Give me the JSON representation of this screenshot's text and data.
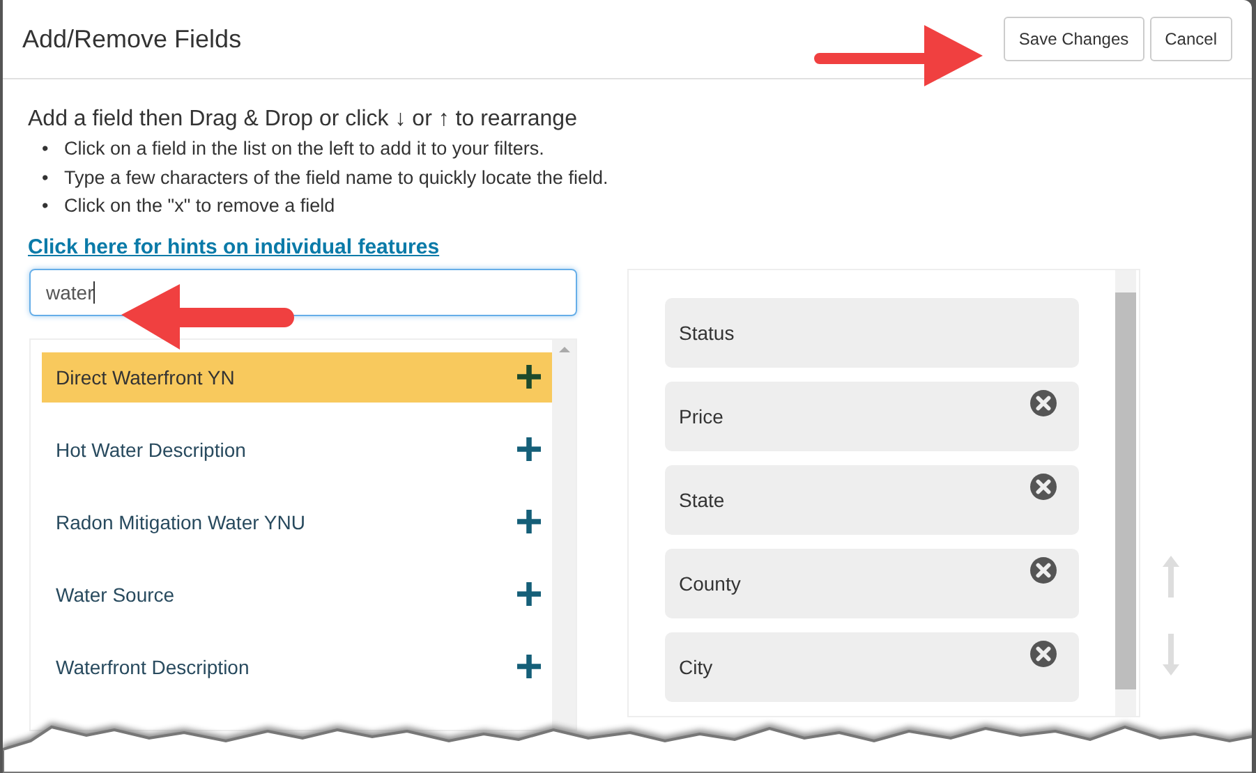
{
  "dialog": {
    "title": "Add/Remove Fields",
    "buttons": [
      "Save Changes",
      "Cancel"
    ]
  },
  "instructions": {
    "heading": "Add a field then Drag & Drop or click ↓ or ↑ to rearrange",
    "bullets": [
      {
        "marker": "•",
        "text": "Click on a field in the list on the left to add it to your filters."
      },
      {
        "marker": "•",
        "text": "Type a few characters of the field name to quickly locate the field."
      },
      {
        "marker": "•",
        "text": "Click on the \"x\" to remove a field"
      }
    ],
    "link": "Click here for hints on individual features"
  },
  "search": {
    "value": "water"
  },
  "available_fields": [
    {
      "label": "Direct Waterfront YN",
      "selected": true
    },
    {
      "label": "Hot Water Description",
      "selected": false
    },
    {
      "label": "Radon Mitigation Water YNU",
      "selected": false
    },
    {
      "label": "Water Source",
      "selected": false
    },
    {
      "label": "Waterfront Description",
      "selected": false
    }
  ],
  "chosen_fields": [
    {
      "label": "Status",
      "removable": false
    },
    {
      "label": "Price",
      "removable": true
    },
    {
      "label": "State",
      "removable": true
    },
    {
      "label": "County",
      "removable": true
    },
    {
      "label": "City",
      "removable": true
    }
  ]
}
